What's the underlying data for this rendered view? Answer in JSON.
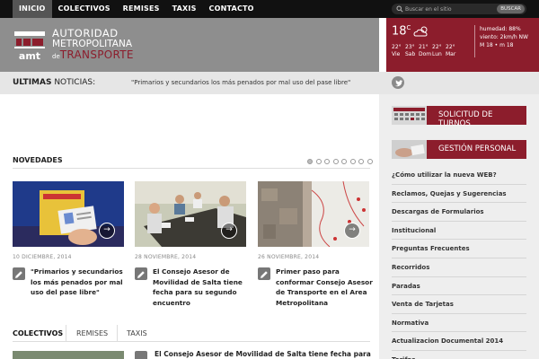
{
  "nav": {
    "items": [
      "INICIO",
      "COLECTIVOS",
      "REMISES",
      "TAXIS",
      "CONTACTO"
    ]
  },
  "search": {
    "placeholder": "Buscar en el sitio",
    "button": "BUSCAR"
  },
  "logo": {
    "line1": "AUTORIDAD",
    "line2": "METROPOLITANA",
    "line3_prefix": "de",
    "line3_main": "TRANSPORTE",
    "mark": "amt"
  },
  "weather": {
    "temp": "18",
    "unit": "C",
    "icon": "cloud-icon",
    "forecast": [
      {
        "temp": "22°",
        "day": "Vie"
      },
      {
        "temp": "23°",
        "day": "Sab"
      },
      {
        "temp": "21°",
        "day": "Dom"
      },
      {
        "temp": "22°",
        "day": "Lun"
      },
      {
        "temp": "22°",
        "day": "Mar"
      }
    ],
    "humidity": "humedad: 88%",
    "wind": "viento: 2km/h NW",
    "minmax": "M 18 • m 18"
  },
  "ticker": {
    "label_bold": "ULTIMAS",
    "label_rest": " NOTICIAS:",
    "text": "\"Primarios y secundarios los más penados por mal uso del pase libre\""
  },
  "novedades": {
    "title": "NOVEDADES",
    "dots_count": 8,
    "cards": [
      {
        "date": "10 DICIEMBRE, 2014",
        "title": "\"Primarios y secundarios los más penados por mal uso del pase libre\""
      },
      {
        "date": "28 NOVIEMBRE, 2014",
        "title": "El Consejo Asesor de Movilidad de Salta tiene fecha para su segundo encuentro"
      },
      {
        "date": "26 NOVIEMBRE, 2014",
        "title": "Primer paso para conformar Consejo Asesor de Transporte en el Area Metropolitana"
      }
    ]
  },
  "tabs": [
    "COLECTIVOS",
    "REMISES",
    "TAXIS"
  ],
  "bottom_news": {
    "title": "El Consejo Asesor de Movilidad de Salta tiene fecha para"
  },
  "sidebar": {
    "banners": [
      "SOLICITUD DE TURNOS",
      "GESTIÓN PERSONAL"
    ],
    "menu": [
      "¿Cómo utilizar la nueva WEB?",
      "Reclamos, Quejas y Sugerencias",
      "Descargas de Formularios",
      "Institucional",
      "Preguntas Frecuentes",
      "Recorridos",
      "Paradas",
      "Venta de Tarjetas",
      "Normativa",
      "Actualizacion Documental 2014",
      "Tarifas"
    ]
  },
  "colors": {
    "brand": "#8c1d2c",
    "topbar": "#111111",
    "header": "#8e8e8e"
  }
}
